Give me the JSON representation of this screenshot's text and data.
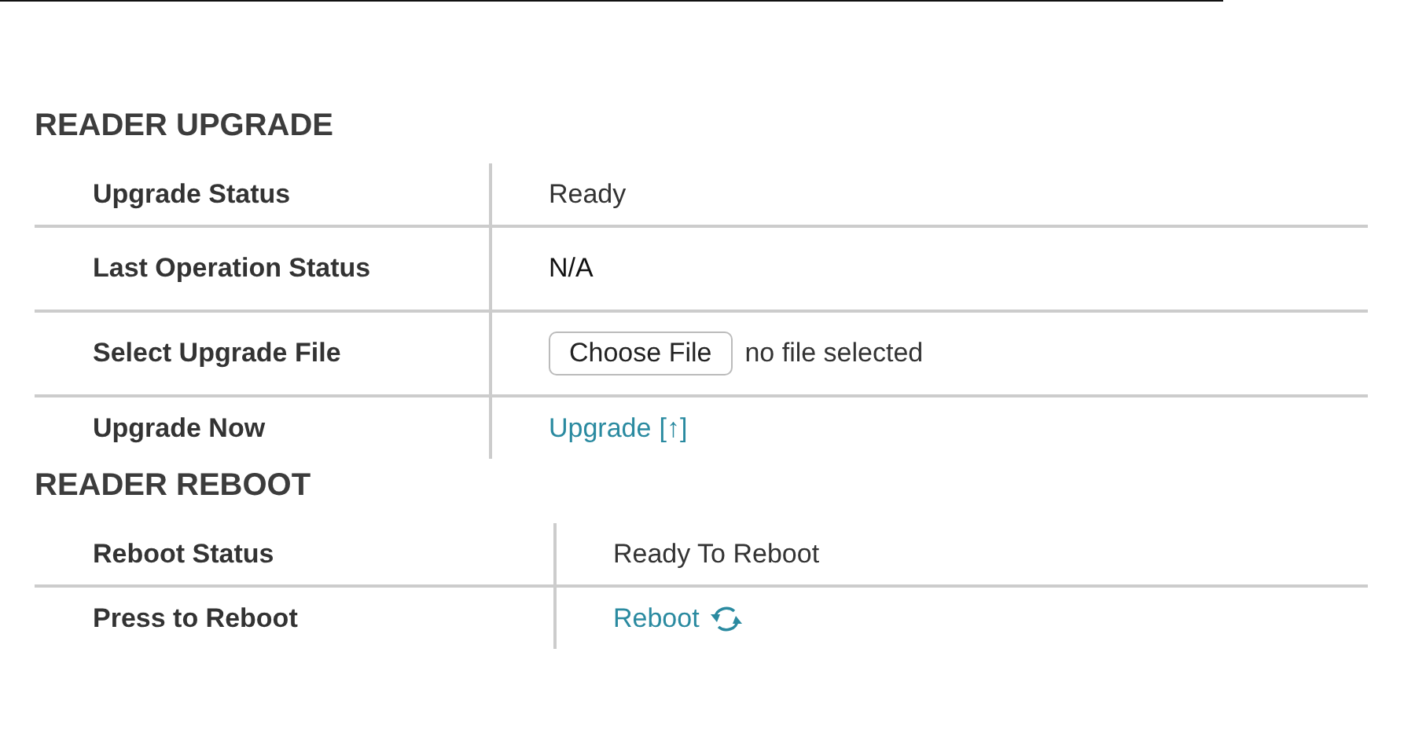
{
  "sections": [
    {
      "title": "READER UPGRADE",
      "rows": [
        {
          "label": "Upgrade Status",
          "kind": "text",
          "value": "Ready"
        },
        {
          "label": "Last Operation Status",
          "kind": "text",
          "value": "N/A"
        },
        {
          "label": "Select Upgrade File",
          "kind": "file",
          "button": "Choose File",
          "value": "no file selected"
        },
        {
          "label": "Upgrade Now",
          "kind": "link",
          "value": "Upgrade",
          "suffix": "[↑]"
        }
      ]
    },
    {
      "title": "READER REBOOT",
      "rows": [
        {
          "label": "Reboot Status",
          "kind": "text",
          "value": "Ready To Reboot"
        },
        {
          "label": "Press to Reboot",
          "kind": "reboot",
          "value": "Reboot"
        }
      ]
    }
  ]
}
